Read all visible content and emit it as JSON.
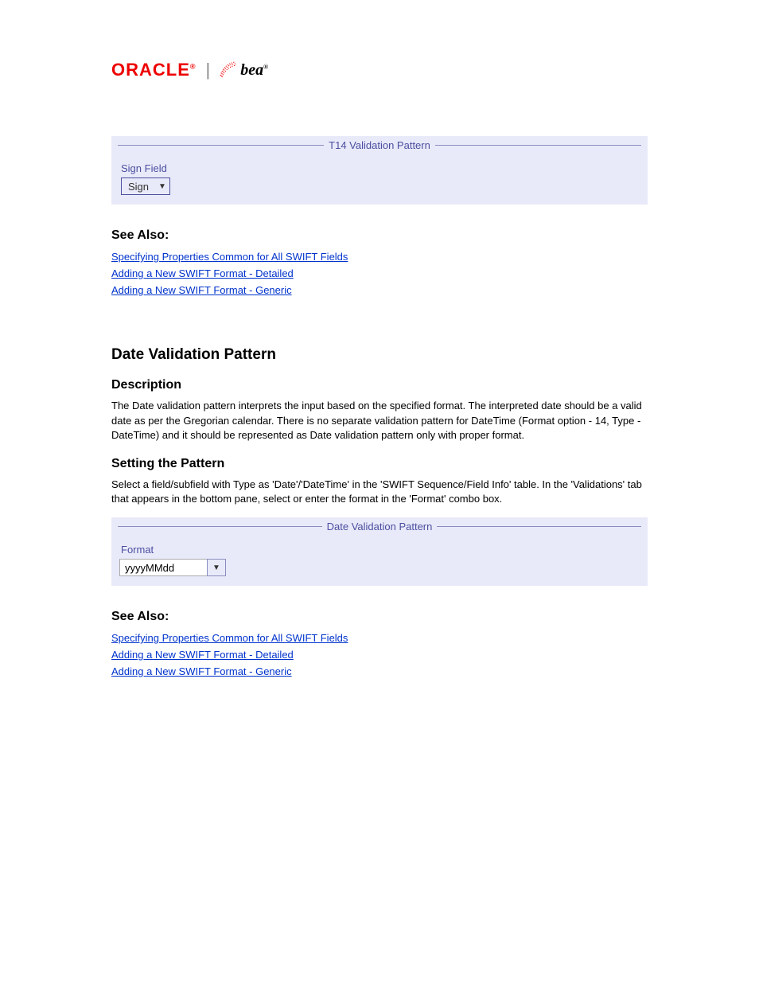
{
  "logo": {
    "oracle": "ORACLE",
    "bea": "bea"
  },
  "panel1": {
    "title": "T14 Validation Pattern",
    "field_label": "Sign Field",
    "dropdown_value": "Sign"
  },
  "seealso1": {
    "heading": "See Also:",
    "links": [
      "Specifying Properties Common for All SWIFT Fields",
      "Adding a New SWIFT Format - Detailed",
      "Adding a New SWIFT Format - Generic"
    ]
  },
  "section": {
    "title": "Date Validation Pattern",
    "description_heading": "Description",
    "description_body": "The Date validation pattern interprets the input based on the specified format. The interpreted date should be a valid date as per the Gregorian calendar. There is no separate validation pattern for DateTime (Format option - 14, Type - DateTime) and it should be represented as Date validation pattern only with proper format.",
    "setting_heading": "Setting the Pattern",
    "setting_body": "Select a field/subfield with Type as 'Date'/'DateTime' in the 'SWIFT Sequence/Field Info' table. In the 'Validations' tab that appears in the bottom pane, select or enter the format in the 'Format' combo box.",
    "setting_extra": "'Format'",
    "right_text": "combo"
  },
  "panel2": {
    "title": "Date Validation Pattern",
    "field_label": "Format",
    "input_value": "yyyyMMdd"
  },
  "seealso2": {
    "heading": "See Also:",
    "links": [
      "Specifying Properties Common for All SWIFT Fields",
      "Adding a New SWIFT Format - Detailed",
      "Adding a New SWIFT Format - Generic"
    ]
  }
}
